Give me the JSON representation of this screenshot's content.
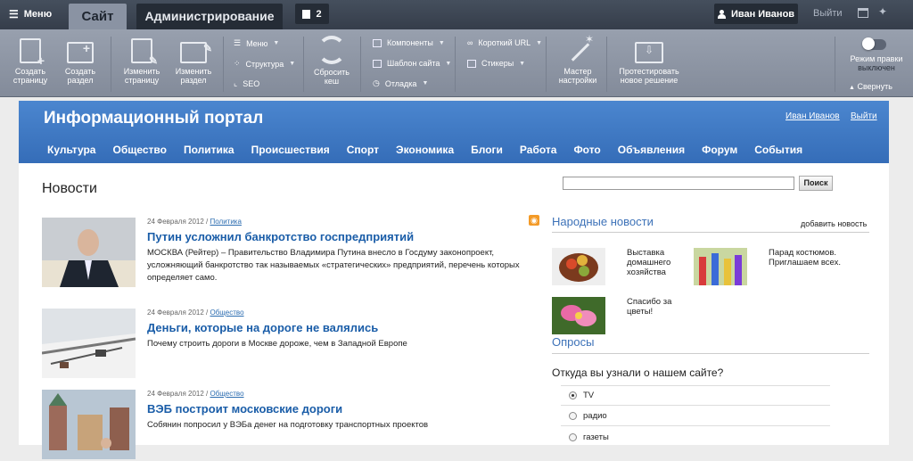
{
  "admin_bar": {
    "menu_label": "Меню",
    "tab_site": "Сайт",
    "tab_admin": "Администрирование",
    "notifications_count": "2",
    "user_name": "Иван Иванов",
    "logout": "Выйти"
  },
  "toolbar": {
    "create_page": [
      "Создать",
      "страницу"
    ],
    "create_section": [
      "Создать",
      "раздел"
    ],
    "edit_page": [
      "Изменить",
      "страницу"
    ],
    "edit_section": [
      "Изменить",
      "раздел"
    ],
    "menu": "Меню",
    "structure": "Структура",
    "seo": "SEO",
    "reset_cache": [
      "Сбросить",
      "кеш"
    ],
    "components": "Компоненты",
    "site_template": "Шаблон сайта",
    "debug": "Отладка",
    "short_url": "Короткий URL",
    "stickers": "Стикеры",
    "wizard": [
      "Мастер",
      "настройки"
    ],
    "test_solution": [
      "Протестировать",
      "новое решение"
    ],
    "edit_mode": "Режим правки",
    "edit_mode_state": "выключен",
    "collapse": "Свернуть"
  },
  "portal": {
    "title": "Информационный портал",
    "user": "Иван Иванов",
    "logout": "Выйти",
    "nav": [
      "Культура",
      "Общество",
      "Политика",
      "Происшествия",
      "Спорт",
      "Экономика",
      "Блоги",
      "Работа",
      "Фото",
      "Объявления",
      "Форум",
      "События"
    ]
  },
  "news": {
    "heading": "Новости",
    "items": [
      {
        "date": "24 Февраля 2012",
        "category": "Политика",
        "title": "Путин усложнил банкротство госпредприятий",
        "text": "МОСКВА (Рейтер) – Правительство Владимира Путина внесло в Госдуму законопроект, усложняющий банкротство так называемых «стратегических» предприятий, перечень которых определяет само."
      },
      {
        "date": "24 Февраля 2012",
        "category": "Общество",
        "title": "Деньги, которые на дороге не валялись",
        "text": "Почему строить дороги в Москве дороже, чем в Западной Европе"
      },
      {
        "date": "24 Февраля 2012",
        "category": "Общество",
        "title": "ВЭБ построит московские дороги",
        "text": "Собянин попросил у ВЭБа денег на подготовку транспортных проектов"
      }
    ]
  },
  "search": {
    "button": "Поиск",
    "value": ""
  },
  "people_news": {
    "heading": "Народные новости",
    "add": "добавить новость",
    "items": [
      {
        "line1": "Выставка",
        "line2": "домашнего",
        "line3": "хозяйства"
      },
      {
        "line1": "Парад костюмов.",
        "line2": "Приглашаем всех.",
        "line3": ""
      },
      {
        "line1": "Спасибо за",
        "line2": "цветы!",
        "line3": ""
      }
    ]
  },
  "poll": {
    "heading": "Опросы",
    "question": "Откуда вы узнали о нашем сайте?",
    "options": [
      "TV",
      "радио",
      "газеты"
    ],
    "selected": "TV"
  }
}
